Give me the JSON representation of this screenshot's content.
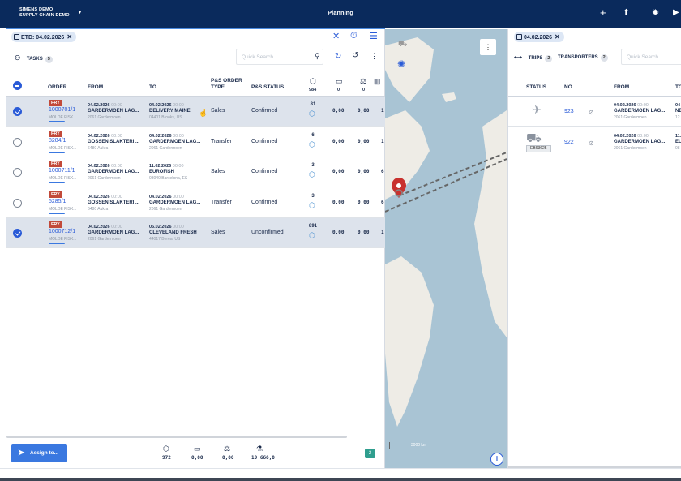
{
  "app": {
    "brand_line1": "SIMENS DEMO",
    "brand_line2": "SUPPLY CHAIN DEMO",
    "title": "Planning"
  },
  "left": {
    "filter_chip": "ETD: 04.02.2026",
    "tasks_label": "TASKS",
    "tasks_count": "5",
    "search_placeholder": "Quick Search",
    "columns": {
      "order": "ORDER",
      "from": "FROM",
      "to": "TO",
      "order_type": "P&S ORDER TYPE",
      "status": "P&S STATUS",
      "pkg_total": "984",
      "vol_total": "0",
      "weight_total": "0"
    },
    "rows": [
      {
        "badge": "FRY",
        "order": "1000701/1",
        "sub": "MOLDE FISK...",
        "from_date": "04.02.2026",
        "from_time": "00:00",
        "from_loc": "GARDERMOEN LAG...",
        "from_addr": "2061 Gardermoen",
        "to_date": "04.02.2026",
        "to_time": "00:00",
        "to_loc": "DELIVERY MAINE",
        "to_addr": "04401 Brooks, US",
        "type": "Sales",
        "status": "Confirmed",
        "pkg": "81",
        "vol": "0,00",
        "weight": "0,00",
        "extra": "1",
        "selected": true
      },
      {
        "badge": "FRY",
        "order": "8284/1",
        "sub": "MOLDE FISK...",
        "from_date": "04.02.2026",
        "from_time": "00:00",
        "from_loc": "GOSSEN SLAKTERI ...",
        "from_addr": "6480 Aukra",
        "to_date": "04.02.2026",
        "to_time": "00:00",
        "to_loc": "GARDERMOEN LAG...",
        "to_addr": "2061 Gardermoen",
        "type": "Transfer",
        "status": "Confirmed",
        "pkg": "6",
        "vol": "0,00",
        "weight": "0,00",
        "extra": "1",
        "selected": false
      },
      {
        "badge": "FRY",
        "order": "1000711/1",
        "sub": "MOLDE FISK...",
        "from_date": "04.02.2026",
        "from_time": "00:00",
        "from_loc": "GARDERMOEN LAG...",
        "from_addr": "2061 Gardermoen",
        "to_date": "11.02.2026",
        "to_time": "00:00",
        "to_loc": "EUROFISH",
        "to_addr": "08040 Barcelona, ES",
        "type": "Sales",
        "status": "Confirmed",
        "pkg": "3",
        "vol": "0,00",
        "weight": "0,00",
        "extra": "6",
        "selected": false
      },
      {
        "badge": "FRY",
        "order": "5285/1",
        "sub": "MOLDE FISK...",
        "from_date": "04.02.2026",
        "from_time": "00:00",
        "from_loc": "GOSSEN SLAKTERI ...",
        "from_addr": "6480 Aukra",
        "to_date": "04.02.2026",
        "to_time": "00:00",
        "to_loc": "GARDERMOEN LAG...",
        "to_addr": "2061 Gardermoen",
        "type": "Transfer",
        "status": "Confirmed",
        "pkg": "3",
        "vol": "0,00",
        "weight": "0,00",
        "extra": "6",
        "selected": false
      },
      {
        "badge": "FRY",
        "order": "1000712/1",
        "sub": "MOLDE FISK...",
        "from_date": "04.02.2026",
        "from_time": "00:00",
        "from_loc": "GARDERMOEN LAG...",
        "from_addr": "2061 Gardermoen",
        "to_date": "05.02.2026",
        "to_time": "00:00",
        "to_loc": "CLEVELAND FRESH",
        "to_addr": "44017 Berea, US",
        "type": "Sales",
        "status": "Unconfirmed",
        "pkg": "891",
        "vol": "0,00",
        "weight": "0,00",
        "extra": "1",
        "selected": true
      }
    ],
    "footer": {
      "assign_label": "Assign to...",
      "pkg": "972",
      "vol": "0,00",
      "weight": "0,00",
      "value": "19 666,0",
      "selected_count": "2"
    }
  },
  "map": {
    "scale_label": "3000 km",
    "colors": {
      "water": "#a9c4d4",
      "land": "#eeece6",
      "marker": "#c8312e"
    }
  },
  "right": {
    "filter_chip": "04.02.2026",
    "trips_label": "TRIPS",
    "trips_count": "2",
    "transporters_label": "TRANSPORTERS",
    "transporters_count": "2",
    "search_placeholder": "Quick Search",
    "columns": {
      "status": "STATUS",
      "no": "NO",
      "from": "FROM",
      "to": "TO"
    },
    "rows": [
      {
        "kind": "plane-icon",
        "no": "923",
        "from_date": "04.02.2026",
        "from_time": "00:00",
        "from_loc": "GARDERMOEN LAG...",
        "from_addr": "2061 Gardermoen",
        "to_date": "04",
        "to_loc": "NE",
        "to_addr": "12",
        "plate": ""
      },
      {
        "kind": "truck-icon",
        "no": "922",
        "from_date": "04.02.2026",
        "from_time": "00:00",
        "from_loc": "GARDERMOEN LAG...",
        "from_addr": "2061 Gardermoen",
        "to_date": "11.",
        "to_loc": "EU",
        "to_addr": "08",
        "plate": "EB63625"
      }
    ]
  }
}
